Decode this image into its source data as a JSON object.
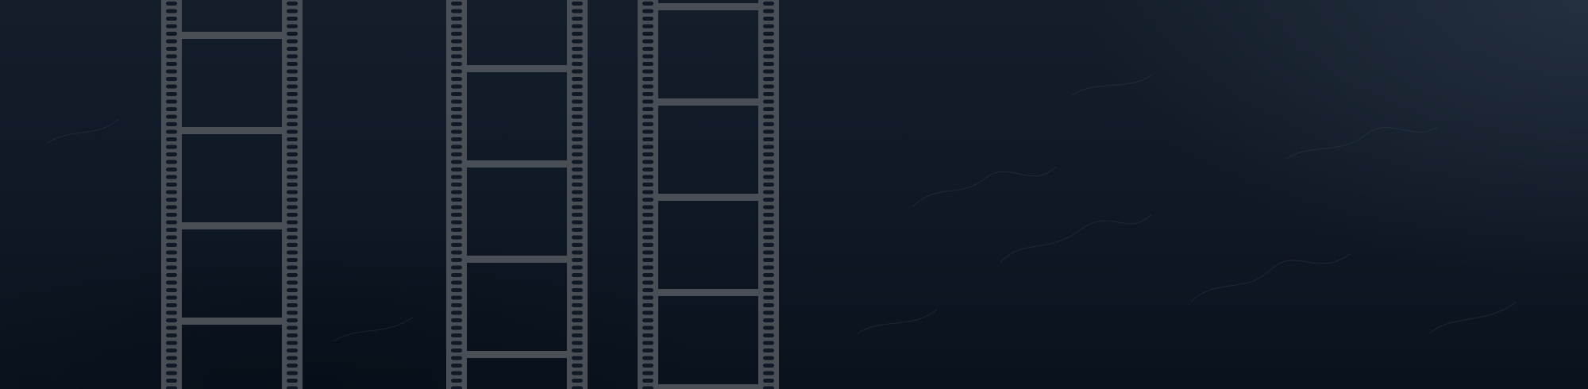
{
  "background": {
    "base_color": "#101a27",
    "highlight_color": "#2b3644",
    "shadow_color": "#060d16"
  },
  "film_strips": [
    {
      "name": "film-strip-left",
      "frame_offset": 0.0
    },
    {
      "name": "film-strip-middle",
      "frame_offset": 0.35
    },
    {
      "name": "film-strip-right",
      "frame_offset": 0.7
    }
  ],
  "film_color": "#4a4e55",
  "hole_color": "#101a27"
}
